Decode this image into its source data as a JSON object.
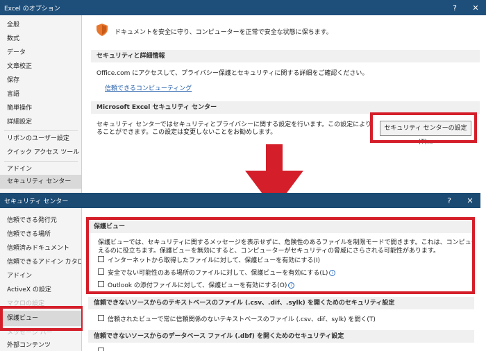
{
  "top_dialog": {
    "title": "Excel のオプション",
    "help": "?",
    "close": "✕",
    "nav": [
      "全般",
      "数式",
      "データ",
      "文章校正",
      "保存",
      "言語",
      "簡単操作",
      "詳細設定",
      "リボンのユーザー設定",
      "クイック アクセス ツール バー",
      "アドイン",
      "セキュリティ センター"
    ],
    "selected_nav": "セキュリティ センター",
    "intro": "ドキュメントを安全に守り、コンピューターを正常で安全な状態に保ちます。",
    "privacy_section": {
      "heading": "セキュリティと詳細情報",
      "text": "Office.com にアクセスして、プライバシー保護とセキュリティに関する詳細をご確認ください。",
      "link": "信頼できるコンピューティング"
    },
    "trust_section": {
      "heading": "Microsoft Excel セキュリティ センター",
      "text_line1": "セキュリティ センターではセキュリティとプライバシーに関する設定を行います。この設定により、コンピューターを保護す",
      "text_line2": "ることができます。この設定は変更しないことをお勧めします。",
      "button": "セキュリティ センターの設定(T)..."
    }
  },
  "bottom_dialog": {
    "title": "セキュリティ センター",
    "help": "?",
    "close": "✕",
    "nav": [
      "信頼できる発行元",
      "信頼できる場所",
      "信頼済みドキュメント",
      "信頼できるアドイン カタログ",
      "アドイン",
      "ActiveX の設定",
      "マクロの設定",
      "保護ビュー",
      "メッセージ バー",
      "外部コンテンツ"
    ],
    "selected_nav": "保護ビュー",
    "protected_view": {
      "heading": "保護ビュー",
      "desc_line1": "保護ビューでは、セキュリティに関するメッセージを表示せずに、危険性のあるファイルを制限モードで開きます。これは、コンピューターへの悪影響を最小限に抑",
      "desc_line2": "えるのに役立ちます。保護ビューを無効にすると、コンピューターがセキュリティの脅威にさらされる可能性があります。",
      "options": [
        "インターネットから取得したファイルに対して、保護ビューを有効にする(I)",
        "安全でない可能性のある場所のファイルに対して、保護ビューを有効にする(L)",
        "Outlook の添付ファイルに対して、保護ビューを有効にする(O)"
      ]
    },
    "text_files": {
      "heading": "信頼できないソースからのテキストベースのファイル (.csv、.dif、.sylk) を開くためのセキュリティ設定",
      "option": "信頼されたビューで常に信頼関係のないテキストベースのファイル (.csv、dif、sylk) を開く(T)"
    },
    "db_files": {
      "heading": "信頼できないソースからのデータベース ファイル (.dbf) を開くためのセキュリティ設定"
    }
  },
  "colors": {
    "titlebar": "#1e4f7a",
    "highlight_red": "#d41f2a",
    "link": "#1e5aa8",
    "shield": "#e8772e"
  }
}
